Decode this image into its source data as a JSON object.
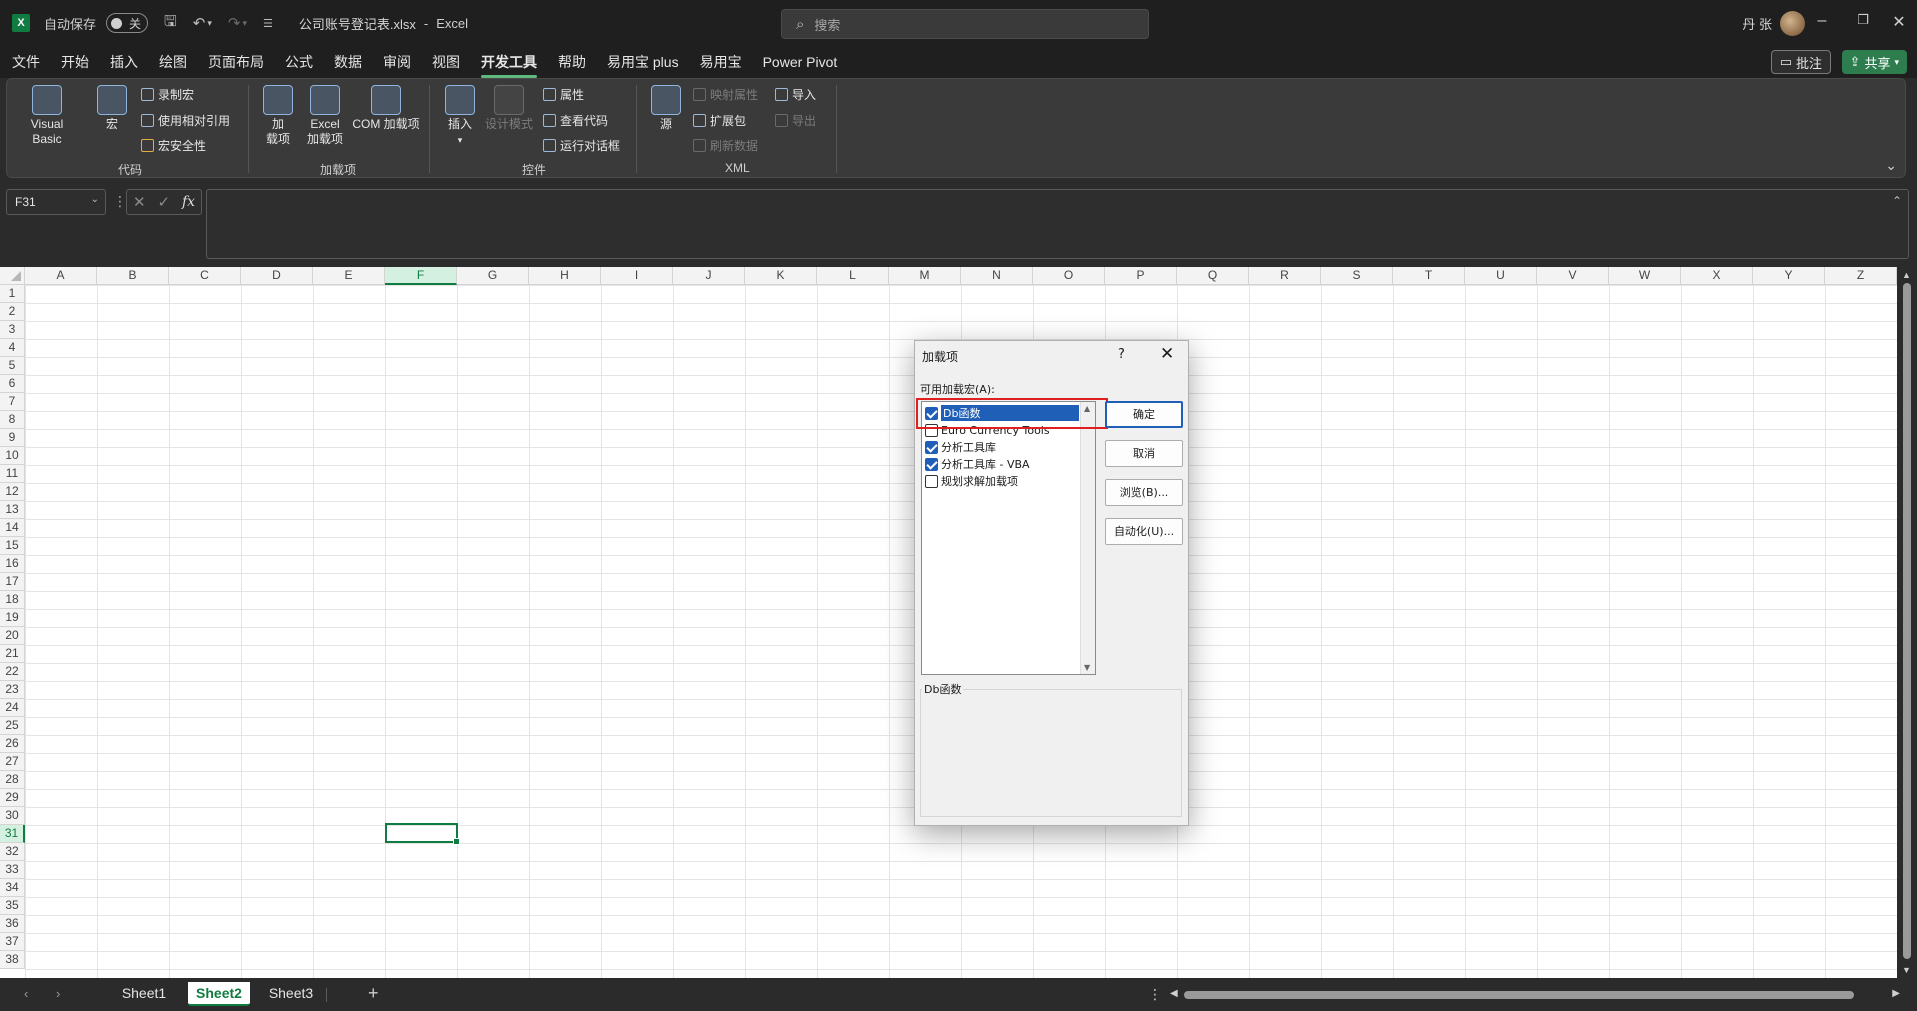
{
  "titlebar": {
    "autosave_label": "自动保存",
    "autosave_state": "关",
    "filename": "公司账号登记表.xlsx",
    "app_separator": "-",
    "app_name": "Excel",
    "search_placeholder": "搜索",
    "user_name": "丹 张"
  },
  "menu": {
    "tabs": [
      "文件",
      "开始",
      "插入",
      "绘图",
      "页面布局",
      "公式",
      "数据",
      "审阅",
      "视图",
      "开发工具",
      "帮助",
      "易用宝 plus",
      "易用宝",
      "Power Pivot"
    ],
    "active_tab": "开发工具",
    "comment_button": "批注",
    "share_button": "共享"
  },
  "ribbon": {
    "code": {
      "label": "代码",
      "visual_basic": "Visual Basic",
      "macros": "宏",
      "record_macro": "录制宏",
      "relative_ref": "使用相对引用",
      "macro_security": "宏安全性"
    },
    "addins": {
      "label": "加载项",
      "addins_line1": "加",
      "addins_line2": "载项",
      "excel_addins_line1": "Excel",
      "excel_addins_line2": "加载项",
      "com_addins": "COM 加载项"
    },
    "controls": {
      "label": "控件",
      "insert": "插入",
      "design_mode": "设计模式",
      "properties": "属性",
      "view_code": "查看代码",
      "run_dialog": "运行对话框"
    },
    "xml": {
      "label": "XML",
      "source": "源",
      "map_properties": "映射属性",
      "expansion_packs": "扩展包",
      "refresh_data": "刷新数据",
      "import": "导入",
      "export": "导出"
    }
  },
  "formula_bar": {
    "name_box": "F31",
    "fx": "fx",
    "formula": ""
  },
  "grid": {
    "columns": [
      "A",
      "B",
      "C",
      "D",
      "E",
      "F",
      "G",
      "H",
      "I",
      "J",
      "K",
      "L",
      "M",
      "N",
      "O",
      "P",
      "Q",
      "R",
      "S",
      "T",
      "U",
      "V",
      "W",
      "X",
      "Y",
      "Z"
    ],
    "rows": [
      "1",
      "2",
      "3",
      "4",
      "5",
      "6",
      "7",
      "8",
      "9",
      "10",
      "11",
      "12",
      "13",
      "14",
      "15",
      "16",
      "17",
      "18",
      "19",
      "20",
      "21",
      "22",
      "23",
      "24",
      "25",
      "26",
      "27",
      "28",
      "29",
      "30",
      "31",
      "32",
      "33",
      "34",
      "35",
      "36",
      "37",
      "38"
    ],
    "active_column": "F",
    "active_row": "31"
  },
  "sheets": {
    "tabs": [
      "Sheet1",
      "Sheet2",
      "Sheet3"
    ],
    "active": "Sheet2"
  },
  "dialog": {
    "title": "加载项",
    "help": "?",
    "list_label": "可用加载宏(A):",
    "addins": [
      {
        "name": "Db函数",
        "checked": true,
        "selected": true
      },
      {
        "name": "Euro Currency Tools",
        "checked": false,
        "selected": false
      },
      {
        "name": "分析工具库",
        "checked": true,
        "selected": false
      },
      {
        "name": "分析工具库 - VBA",
        "checked": true,
        "selected": false
      },
      {
        "name": "规划求解加载项",
        "checked": false,
        "selected": false
      }
    ],
    "ok": "确定",
    "cancel": "取消",
    "browse": "浏览(B)...",
    "automation": "自动化(U)...",
    "description_title": "Db函数"
  }
}
